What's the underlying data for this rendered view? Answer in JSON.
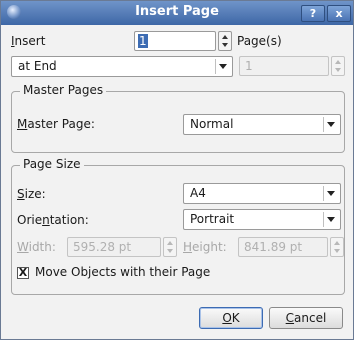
{
  "window": {
    "title": "Insert Page",
    "help_label": "?",
    "close_label": "x"
  },
  "insert": {
    "label_prefix": "",
    "label_mnemonic": "I",
    "label_rest": "nsert",
    "count_value": "1",
    "pages_label": "Page(s)",
    "position_value": "at End",
    "page_number_value": "1"
  },
  "master_pages": {
    "group_title": "Master Pages",
    "label_mnemonic": "M",
    "label_rest": "aster Page:",
    "value": "Normal"
  },
  "page_size": {
    "group_title": "Page Size",
    "size_label_mnemonic": "S",
    "size_label_rest": "ize:",
    "size_value": "A4",
    "orientation_label_prefix": "Orie",
    "orientation_label_mnemonic": "n",
    "orientation_label_rest": "tation:",
    "orientation_value": "Portrait",
    "width_label_mnemonic": "W",
    "width_label_rest": "idth:",
    "width_value": "595.28 pt",
    "height_label_mnemonic": "H",
    "height_label_rest": "eight:",
    "height_value": "841.89 pt",
    "move_objects_label": "Move Objects with their Page",
    "move_objects_checked": true,
    "check_glyph": "X"
  },
  "buttons": {
    "ok_mnemonic": "O",
    "ok_rest": "K",
    "cancel_mnemonic": "C",
    "cancel_rest": "ancel"
  }
}
